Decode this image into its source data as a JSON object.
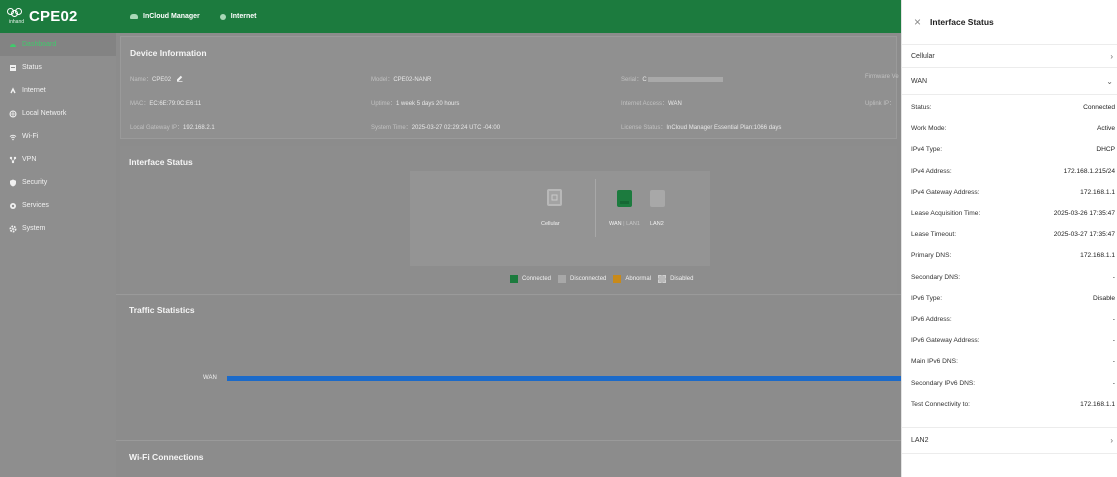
{
  "sidebar": {
    "logo_brand": "inhand",
    "device_name": "CPE02",
    "items": [
      {
        "label": "Dashboard",
        "icon": "dashboard-icon",
        "active": true
      },
      {
        "label": "Status",
        "icon": "status-icon"
      },
      {
        "label": "Internet",
        "icon": "internet-icon"
      },
      {
        "label": "Local Network",
        "icon": "local-network-icon"
      },
      {
        "label": "Wi-Fi",
        "icon": "wifi-icon"
      },
      {
        "label": "VPN",
        "icon": "vpn-icon"
      },
      {
        "label": "Security",
        "icon": "security-icon"
      },
      {
        "label": "Services",
        "icon": "services-icon"
      },
      {
        "label": "System",
        "icon": "system-icon"
      }
    ]
  },
  "topbar": {
    "cloud_label": "InCloud Manager",
    "internet_label": "Internet"
  },
  "device_info": {
    "title": "Device Information",
    "name_label": "Name：",
    "name_value": "CPE02",
    "model_label": "Model：",
    "model_value": "CPE02-NANR",
    "serial_label": "Serial：",
    "serial_value": "C",
    "firmware_label": "Firmware Ve",
    "mac_label": "MAC：",
    "mac_value": "EC:6E:79:0C:E6:11",
    "uptime_label": "Uptime：",
    "uptime_value": "1 week 5 days 20 hours",
    "access_label": "Internet Access：",
    "access_value": "WAN",
    "uplink_label": "Uplink IP：",
    "gateway_label": "Local Gateway IP：",
    "gateway_value": "192.168.2.1",
    "time_label": "System Time：",
    "time_value": "2025-03-27 02:29:24 UTC -04:00",
    "license_label": "License Status：",
    "license_value": "InCloud Manager Essential Plan:1066 days"
  },
  "interface_status": {
    "title": "Interface Status",
    "ports": [
      {
        "label": "Cellular"
      },
      {
        "label": "WAN",
        "sub": "LAN1"
      },
      {
        "label": "LAN2"
      }
    ],
    "legend": [
      {
        "label": "Connected",
        "color": "#1c7b3e"
      },
      {
        "label": "Disconnected",
        "color": "#a8a8a8"
      },
      {
        "label": "Abnormal",
        "color": "#c88a1a"
      },
      {
        "label": "Disabled",
        "color": "#b9b9b9"
      }
    ]
  },
  "traffic": {
    "title": "Traffic Statistics",
    "series_label": "WAN",
    "bar_color": "#1b6ac9"
  },
  "wifi": {
    "title": "Wi-Fi Connections"
  },
  "drawer": {
    "title": "Interface Status",
    "cellular_label": "Cellular",
    "wan_label": "WAN",
    "rows": [
      {
        "k": "Status:",
        "v": "Connected"
      },
      {
        "k": "Work Mode:",
        "v": "Active"
      },
      {
        "k": "IPv4 Type:",
        "v": "DHCP"
      },
      {
        "k": "IPv4 Address:",
        "v": "172.168.1.215/24"
      },
      {
        "k": "IPv4 Gateway Address:",
        "v": "172.168.1.1"
      },
      {
        "k": "Lease Acquisition Time:",
        "v": "2025-03-26 17:35:47"
      },
      {
        "k": "Lease Timeout:",
        "v": "2025-03-27 17:35:47"
      },
      {
        "k": "Primary DNS:",
        "v": "172.168.1.1"
      },
      {
        "k": "Secondary DNS:",
        "v": "-"
      },
      {
        "k": "IPv6 Type:",
        "v": "Disable"
      },
      {
        "k": "IPv6 Address:",
        "v": "-"
      },
      {
        "k": "IPv6 Gateway Address:",
        "v": "-"
      },
      {
        "k": "Main IPv6 DNS:",
        "v": "-"
      },
      {
        "k": "Secondary IPv6 DNS:",
        "v": "-"
      },
      {
        "k": "Test Connectivity to:",
        "v": "172.168.1.1"
      }
    ],
    "lan2_label": "LAN2"
  }
}
